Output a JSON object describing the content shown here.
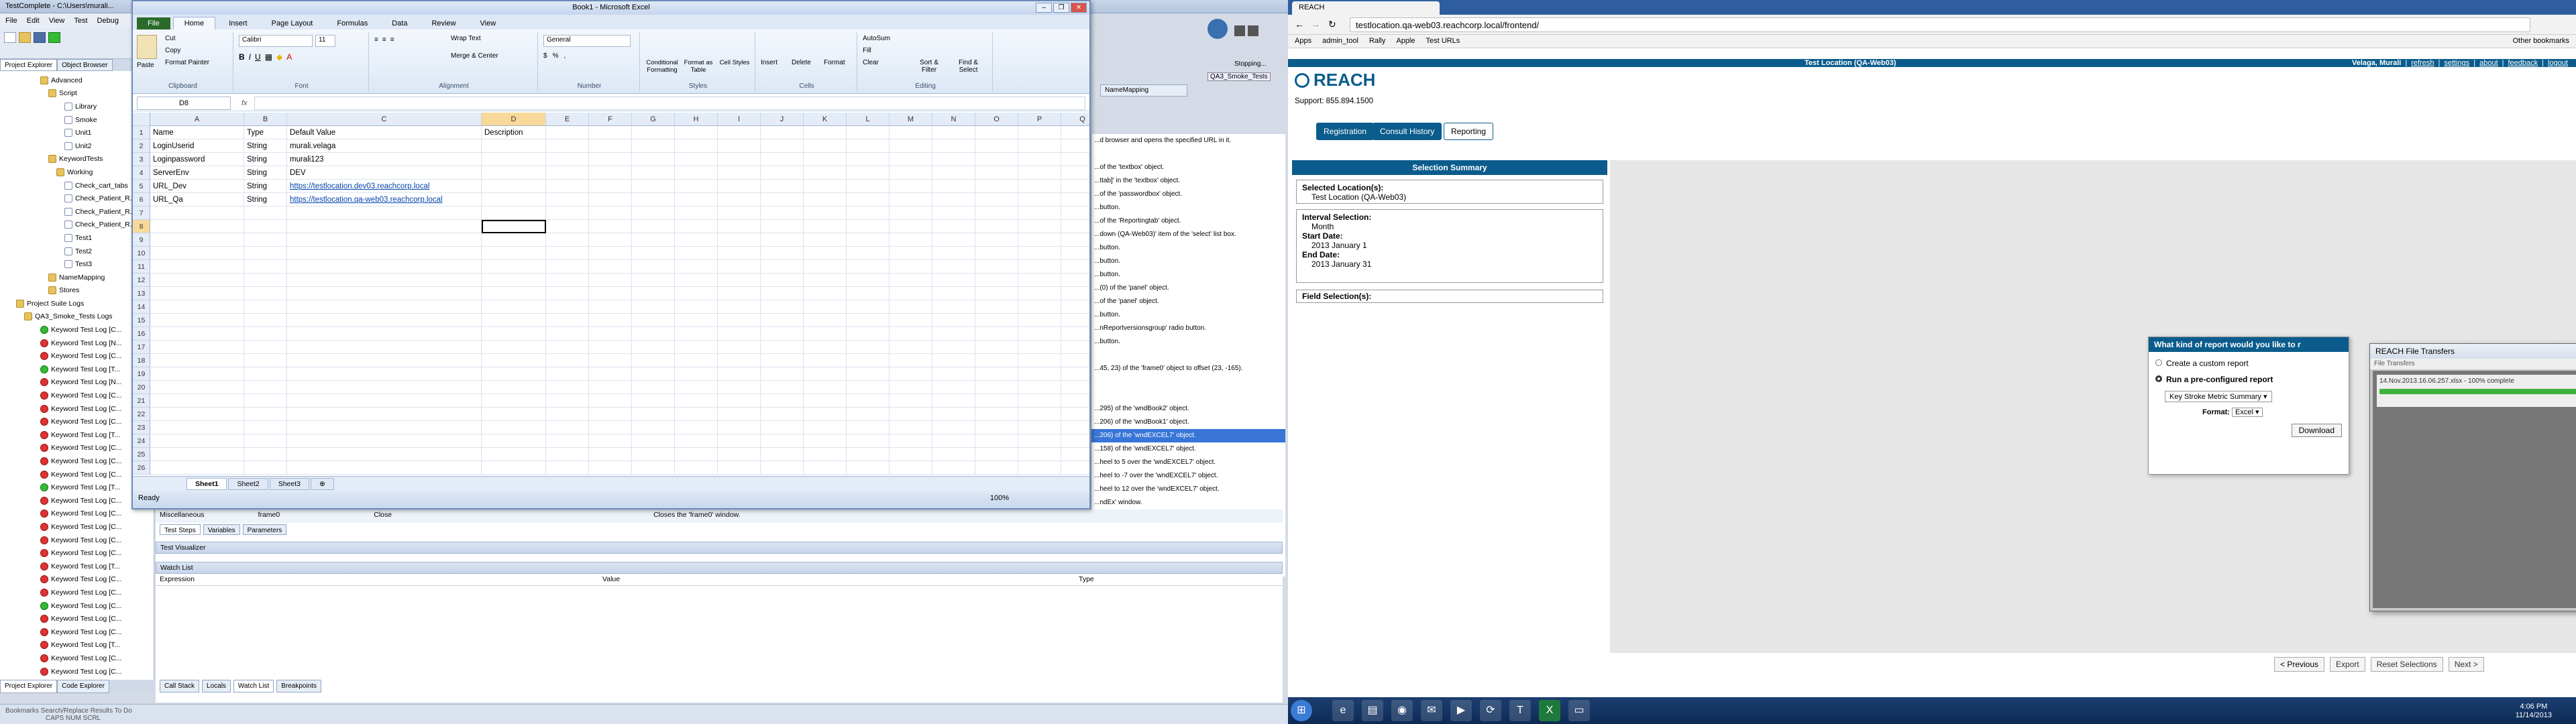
{
  "tc": {
    "title": "TestComplete - C:\\Users\\murali...",
    "menu": [
      "File",
      "Edit",
      "View",
      "Test",
      "Debug"
    ],
    "panel_tabs": [
      "Project Explorer",
      "Object Browser"
    ],
    "bottom_tabs": [
      "Project Explorer",
      "Code Explorer"
    ],
    "status": "Bookmarks    Search/Replace Results    To Do",
    "status_keys": "CAPS  NUM  SCRL",
    "stopping": "Stopping...",
    "run_label": "QA3_Smoke_Tests",
    "tree": [
      {
        "label": "Advanced",
        "icon": "folder",
        "indent": 60
      },
      {
        "label": "Script",
        "icon": "folder",
        "indent": 72
      },
      {
        "label": "Library",
        "icon": "doc",
        "indent": 96
      },
      {
        "label": "Smoke",
        "icon": "doc",
        "indent": 96
      },
      {
        "label": "Unit1",
        "icon": "doc",
        "indent": 96
      },
      {
        "label": "Unit2",
        "icon": "doc",
        "indent": 96
      },
      {
        "label": "KeywordTests",
        "icon": "folder",
        "indent": 72
      },
      {
        "label": "Working",
        "icon": "folder",
        "indent": 84
      },
      {
        "label": "Check_cart_tabs",
        "icon": "doc",
        "indent": 96
      },
      {
        "label": "Check_Patient_R...",
        "icon": "doc",
        "indent": 96
      },
      {
        "label": "Check_Patient_R...",
        "icon": "doc",
        "indent": 96
      },
      {
        "label": "Check_Patient_R...",
        "icon": "doc",
        "indent": 96
      },
      {
        "label": "Test1",
        "icon": "doc",
        "indent": 96
      },
      {
        "label": "Test2",
        "icon": "doc",
        "indent": 96
      },
      {
        "label": "Test3",
        "icon": "doc",
        "indent": 96
      },
      {
        "label": "NameMapping",
        "icon": "folder",
        "indent": 72
      },
      {
        "label": "Stores",
        "icon": "folder",
        "indent": 72
      },
      {
        "label": "Project Suite Logs",
        "icon": "folder",
        "indent": 24
      },
      {
        "label": "QA3_Smoke_Tests Logs",
        "icon": "folder",
        "indent": 36
      },
      {
        "label": "Keyword Test Log [C...",
        "icon": "ok",
        "indent": 60
      },
      {
        "label": "Keyword Test Log [N...",
        "icon": "err",
        "indent": 60
      },
      {
        "label": "Keyword Test Log [C...",
        "icon": "err",
        "indent": 60
      },
      {
        "label": "Keyword Test Log [T...",
        "icon": "ok",
        "indent": 60
      },
      {
        "label": "Keyword Test Log [N...",
        "icon": "err",
        "indent": 60
      },
      {
        "label": "Keyword Test Log [C...",
        "icon": "err",
        "indent": 60
      },
      {
        "label": "Keyword Test Log [C...",
        "icon": "err",
        "indent": 60
      },
      {
        "label": "Keyword Test Log [C...",
        "icon": "err",
        "indent": 60
      },
      {
        "label": "Keyword Test Log [T...",
        "icon": "err",
        "indent": 60
      },
      {
        "label": "Keyword Test Log [C...",
        "icon": "err",
        "indent": 60
      },
      {
        "label": "Keyword Test Log [C...",
        "icon": "err",
        "indent": 60
      },
      {
        "label": "Keyword Test Log [C...",
        "icon": "err",
        "indent": 60
      },
      {
        "label": "Keyword Test Log [T...",
        "icon": "ok",
        "indent": 60
      },
      {
        "label": "Keyword Test Log [C...",
        "icon": "err",
        "indent": 60
      },
      {
        "label": "Keyword Test Log [C...",
        "icon": "err",
        "indent": 60
      },
      {
        "label": "Keyword Test Log [C...",
        "icon": "err",
        "indent": 60
      },
      {
        "label": "Keyword Test Log [C...",
        "icon": "err",
        "indent": 60
      },
      {
        "label": "Keyword Test Log [C...",
        "icon": "err",
        "indent": 60
      },
      {
        "label": "Keyword Test Log [T...",
        "icon": "err",
        "indent": 60
      },
      {
        "label": "Keyword Test Log [C...",
        "icon": "err",
        "indent": 60
      },
      {
        "label": "Keyword Test Log [C...",
        "icon": "err",
        "indent": 60
      },
      {
        "label": "Keyword Test Log [C...",
        "icon": "ok",
        "indent": 60
      },
      {
        "label": "Keyword Test Log [C...",
        "icon": "err",
        "indent": 60
      },
      {
        "label": "Keyword Test Log [C...",
        "icon": "err",
        "indent": 60
      },
      {
        "label": "Keyword Test Log [T...",
        "icon": "err",
        "indent": 60
      },
      {
        "label": "Keyword Test Log [C...",
        "icon": "err",
        "indent": 60
      },
      {
        "label": "Keyword Test Log [C...",
        "icon": "err",
        "indent": 60
      }
    ],
    "log": [
      "...d browser and opens the specified URL in it.",
      "",
      "...of the 'textbox' object.",
      "...ttab]' in the 'textbox' object.",
      "...of the 'passwordbox' object.",
      "...button.",
      "...of the 'Reportingtab' object.",
      "...down (QA-Web03)' item of the 'select' list box.",
      "...button.",
      "...button.",
      "...button.",
      "...(0) of the 'panel' object.",
      "...of the 'panel' object.",
      "...button.",
      "...nReportversionsgroup' radio button.",
      "...button.",
      "",
      "...45, 23) of the 'frame0' object to offset (23, -165).",
      "",
      "",
      "...295) of the 'wndBook2' object.",
      "...206) of the 'wndBook1' object.",
      "...206) of the 'wndEXCEL7' object.",
      "...158) of the 'wndEXCEL7' object.",
      "...heel to 5 over the 'wndEXCEL7' object.",
      "...heel to -7 over the 'wndEXCEL7' object.",
      "...heel to 12 over the 'wndEXCEL7' object.",
      "...ndEx' window.",
      "",
      "...'frame0' window."
    ],
    "log_highlight": 22,
    "name_mapping_tab": "NameMapping",
    "lower": {
      "misc": "Miscellaneous",
      "frame": "frame0",
      "close": "Close",
      "closes": "Closes the 'frame0' window.",
      "tabs": [
        "Test Steps",
        "Variables",
        "Parameters"
      ],
      "visualizer": "Test Visualizer",
      "watch": "Watch List",
      "cols": [
        "Expression",
        "Value",
        "Type"
      ],
      "btabs": [
        "Call Stack",
        "Locals",
        "Watch List",
        "Breakpoints"
      ]
    }
  },
  "excel": {
    "title": "Book1 - Microsoft Excel",
    "tabs": [
      "File",
      "Home",
      "Insert",
      "Page Layout",
      "Formulas",
      "Data",
      "Review",
      "View"
    ],
    "ribbon_groups": [
      "Clipboard",
      "Font",
      "Alignment",
      "Number",
      "Styles",
      "Cells",
      "Editing"
    ],
    "clip": [
      "Paste",
      "Cut",
      "Copy",
      "Format Painter"
    ],
    "font": "Calibri",
    "size": "11",
    "number_fmt": "General",
    "wrap": "Wrap Text",
    "merge": "Merge & Center",
    "styles": [
      "Conditional Formatting",
      "Format as Table",
      "Cell Styles"
    ],
    "cells": [
      "Insert",
      "Delete",
      "Format"
    ],
    "editing": [
      "AutoSum",
      "Fill",
      "Clear",
      "Sort & Filter",
      "Find & Select"
    ],
    "name_box": "D8",
    "fx": "fx",
    "columns": [
      "A",
      "B",
      "C",
      "D",
      "E",
      "F",
      "G",
      "H",
      "I",
      "J",
      "K",
      "L",
      "M",
      "N",
      "O",
      "P",
      "Q"
    ],
    "rows": [
      [
        "Name",
        "Type",
        "Default Value",
        "Description"
      ],
      [
        "LoginUserid",
        "String",
        "murali.velaga",
        ""
      ],
      [
        "Loginpassword",
        "String",
        "murali123",
        ""
      ],
      [
        "ServerEnv",
        "String",
        "DEV",
        ""
      ],
      [
        "URL_Dev",
        "String",
        "https://testlocation.dev03.reachcorp.local",
        ""
      ],
      [
        "URL_Qa",
        "String",
        "https://testlocation.qa-web03.reachcorp.local",
        ""
      ]
    ],
    "row_count": 27,
    "sheets": [
      "Sheet1",
      "Sheet2",
      "Sheet3"
    ],
    "status": "Ready",
    "zoom": "100%"
  },
  "chrome": {
    "tab": "REACH",
    "url": "testlocation.qa-web03.reachcorp.local/frontend/",
    "bookmarks": [
      "Apps",
      "admin_tool",
      "Rally",
      "Apple",
      "Test URLs"
    ],
    "other_bookmarks": "Other bookmarks"
  },
  "reach": {
    "logo": "REACH",
    "support": "Support: 855.894.1500",
    "location_title": "Test Location (QA-Web03)",
    "user": "Velaga, Murali",
    "links": [
      "refresh",
      "settings",
      "about",
      "feedback",
      "logout"
    ],
    "nav": [
      "Registration",
      "Consult History",
      "Reporting"
    ],
    "summary_title": "Selection Summary",
    "selected_location_label": "Selected Location(s):",
    "selected_location": "Test Location (QA-Web03)",
    "interval_label": "Interval Selection:",
    "interval": "Month",
    "start_label": "Start Date:",
    "start": "2013 January 1",
    "end_label": "End Date:",
    "end": "2013 January 31",
    "fields_label": "Field Selection(s):",
    "dialog_title": "What kind of report would you like to r",
    "custom": "Create a custom report",
    "preconf": "Run a pre-configured report",
    "report_select": "Key Stroke Metric Summary",
    "format_label": "Format:",
    "format": "Excel",
    "download": "Download",
    "bottom": [
      "< Previous",
      "Export",
      "Reset Selections",
      "Next >"
    ],
    "ft_title": "REACH File Transfers",
    "ft_menu": "File  Transfers",
    "ft_item": "14.Nov.2013.16.06.257.xlsx - 100% complete",
    "clock_time": "4:06 PM",
    "clock_date": "11/14/2013"
  }
}
